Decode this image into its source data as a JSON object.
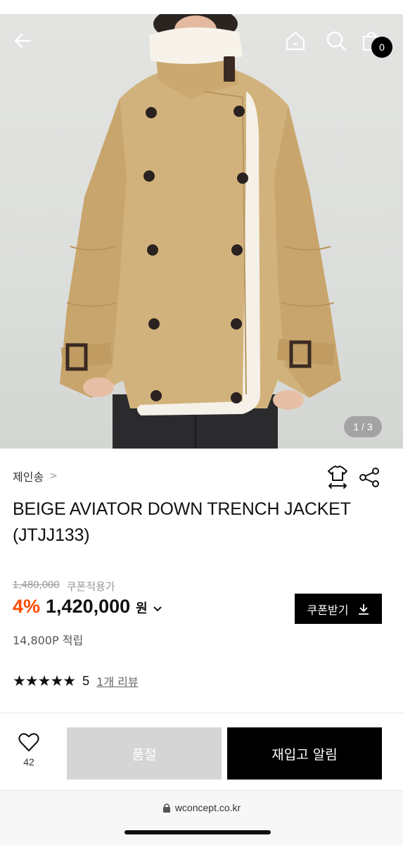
{
  "header": {
    "back_icon": "arrow-left-icon",
    "home_icon": "home-icon",
    "search_icon": "search-icon",
    "bag_icon": "shopping-bag-icon",
    "cart_count": "0"
  },
  "gallery": {
    "indicator": "1 / 3"
  },
  "product": {
    "brand": "제인송",
    "brand_chevron": ">",
    "title_line1": "BEIGE AVIATOR DOWN TRENCH JACKET",
    "title_line2": "(JTJJ133)",
    "original_price": "1,480,000",
    "coupon_note": "쿠폰적용가",
    "discount": "4%",
    "price": "1,420,000",
    "currency": "원",
    "coupon_button": "쿠폰받기",
    "points": "14,800P 적립",
    "stars": "★★★★★",
    "rating": "5",
    "review_link": "1개 리뷰"
  },
  "actions": {
    "like_count": "42",
    "soldout_label": "품절",
    "restock_label": "재입고 알림"
  },
  "browser": {
    "url": "wconcept.co.kr"
  },
  "colors": {
    "accent": "#ff4a00",
    "jacket": "#d2b27c",
    "button_dark": "#000000",
    "button_disabled": "#d5d5d5"
  }
}
